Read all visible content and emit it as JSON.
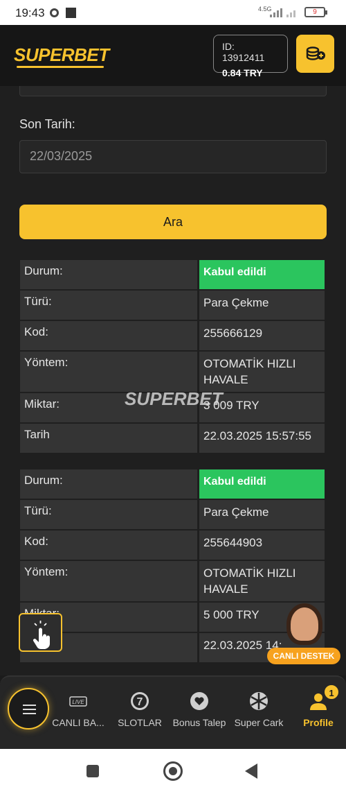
{
  "status_bar": {
    "time": "19:43",
    "network": "4.5G",
    "battery": "9"
  },
  "header": {
    "logo": "SUPERBET",
    "account_id": "ID: 13912411",
    "balance": "0.84 TRY"
  },
  "filter": {
    "end_date_label": "Son Tarih:",
    "end_date_value": "22/03/2025",
    "search_button": "Ara"
  },
  "transactions": [
    {
      "rows": [
        {
          "key": "Durum:",
          "value": "Kabul edildi",
          "status": true
        },
        {
          "key": "Türü:",
          "value": "Para Çekme"
        },
        {
          "key": "Kod:",
          "value": "255666129"
        },
        {
          "key": "Yöntem:",
          "value": "OTOMATİK HIZLI HAVALE"
        },
        {
          "key": "Miktar:",
          "value": "3 009 TRY"
        },
        {
          "key": "Tarih",
          "value": "22.03.2025 15:57:55"
        }
      ]
    },
    {
      "rows": [
        {
          "key": "Durum:",
          "value": "Kabul edildi",
          "status": true
        },
        {
          "key": "Türü:",
          "value": "Para Çekme"
        },
        {
          "key": "Kod:",
          "value": "255644903"
        },
        {
          "key": "Yöntem:",
          "value": "OTOMATİK HIZLI HAVALE"
        },
        {
          "key": "Miktar:",
          "value": "5 000 TRY"
        },
        {
          "key": "Tarih",
          "value": "22.03.2025 14:"
        }
      ]
    }
  ],
  "watermark": "SUPERBET",
  "support": {
    "label": "CANLI DESTEK"
  },
  "bottom_nav": {
    "items": [
      {
        "label": "CANLI BA...",
        "icon": "live-tv-icon"
      },
      {
        "label": "SLOTLAR",
        "icon": "slot-seven-icon"
      },
      {
        "label": "Bonus Talep",
        "icon": "heart-icon"
      },
      {
        "label": "Super Cark",
        "icon": "wheel-icon"
      },
      {
        "label": "Profile",
        "icon": "user-icon",
        "badge": "1"
      }
    ]
  },
  "colors": {
    "accent": "#f7c22e",
    "success": "#2bc55e",
    "background": "#1f1f1f",
    "cell": "#343434"
  }
}
